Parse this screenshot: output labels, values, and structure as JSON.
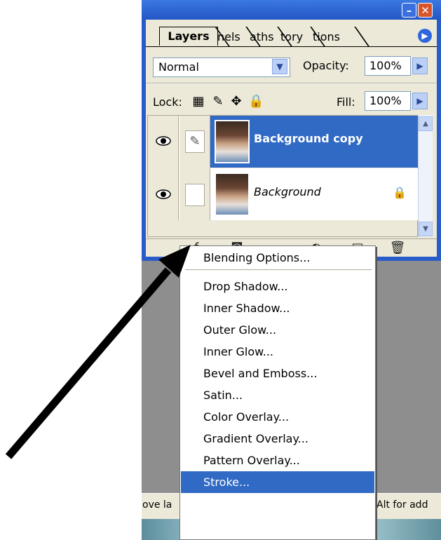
{
  "panel": {
    "tabs": [
      {
        "label": "Layers"
      },
      {
        "label": "nels"
      },
      {
        "label": "aths"
      },
      {
        "label": "tory"
      },
      {
        "label": "tions"
      }
    ],
    "blend_mode": "Normal",
    "opacity_label": "Opacity:",
    "opacity_value": "100%",
    "lock_label": "Lock:",
    "fill_label": "Fill:",
    "fill_value": "100%",
    "layers": [
      {
        "name": "Background copy",
        "selected": true,
        "visible": true
      },
      {
        "name": "Background",
        "selected": false,
        "visible": true,
        "locked": true
      }
    ],
    "bottom_tools": [
      "layer-style-icon",
      "add-mask-icon",
      "new-group-icon",
      "adjustment-layer-icon",
      "new-layer-icon",
      "trash-icon"
    ]
  },
  "menu": {
    "items": [
      {
        "label": "Blending Options..."
      },
      {
        "label": "Drop Shadow..."
      },
      {
        "label": "Inner Shadow..."
      },
      {
        "label": "Outer Glow..."
      },
      {
        "label": "Inner Glow..."
      },
      {
        "label": "Bevel and Emboss..."
      },
      {
        "label": "Satin..."
      },
      {
        "label": "Color Overlay..."
      },
      {
        "label": "Gradient Overlay..."
      },
      {
        "label": "Pattern Overlay..."
      },
      {
        "label": "Stroke..."
      }
    ],
    "selected_item": "Stroke..."
  },
  "status": {
    "left_text": "ove la",
    "right_text": "Alt for add"
  },
  "colors": {
    "panel_frame": "#2a5cc9",
    "selection": "#316ac5",
    "panel_bg": "#ece9d8",
    "workspace": "#8e8e8e"
  }
}
